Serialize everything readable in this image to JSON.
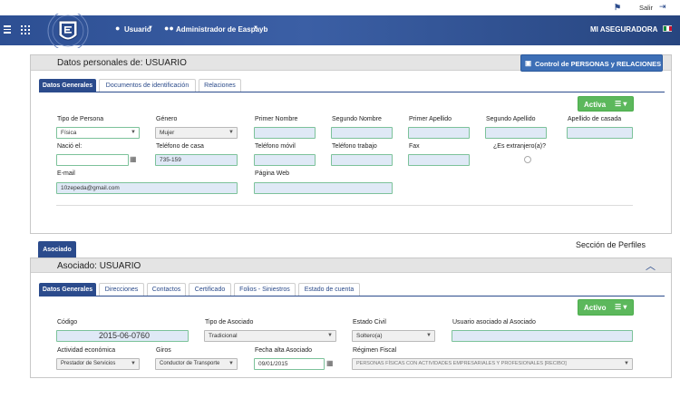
{
  "header": {
    "salir_label": "Salir",
    "usuario_menu": "Usuario",
    "admin_menu": "Administrador de Easpayb",
    "company": "MI ASEGURADORA"
  },
  "personal": {
    "title": "Datos personales de: USUARIO",
    "control_button": "Control de PERSONAS y RELACIONES",
    "tabs": [
      "Datos Generales",
      "Documentos de identificación",
      "Relaciones"
    ],
    "activa_button": "Activa",
    "fields": {
      "tipo_persona_label": "Tipo de Persona",
      "tipo_persona_value": "Física",
      "genero_label": "Género",
      "genero_value": "Mujer",
      "primer_nombre_label": "Primer Nombre",
      "segundo_nombre_label": "Segundo Nombre",
      "primer_apellido_label": "Primer Apellido",
      "segundo_apellido_label": "Segundo Apellido",
      "apellido_casada_label": "Apellido de casada",
      "nacio_label": "Nació el:",
      "tel_casa_label": "Teléfono de casa",
      "tel_casa_value": "735-159",
      "tel_movil_label": "Teléfono móvil",
      "tel_trabajo_label": "Teléfono trabajo",
      "fax_label": "Fax",
      "extranjero_label": "¿Es extranjero(a)?",
      "email_label": "E-mail",
      "email_value": "10zepeda@gmail.com",
      "web_label": "Página Web"
    }
  },
  "asociado": {
    "side_tab": "Asociado",
    "perfiles_label": "Sección de Perfiles",
    "title": "Asociado: USUARIO",
    "tabs": [
      "Datos Generales",
      "Direcciones",
      "Contactos",
      "Certificado",
      "Folios - Siniestros",
      "Estado de cuenta"
    ],
    "activo_button": "Activo",
    "fields": {
      "codigo_label": "Código",
      "codigo_value": "2015-06-0760",
      "tipo_asociado_label": "Tipo de Asociado",
      "tipo_asociado_value": "Tradicional",
      "estado_civil_label": "Estado Civil",
      "estado_civil_value": "Soltero(a)",
      "usuario_asociado_label": "Usuario asociado al Asociado",
      "actividad_label": "Actividad económica",
      "actividad_value": "Prestador de Servicios",
      "giros_label": "Giros",
      "giros_value": "Conductor de Transporte",
      "fecha_alta_label": "Fecha alta Asociado",
      "fecha_alta_value": "09/01/2015",
      "regimen_label": "Régimen Fiscal",
      "regimen_value": "PERSONAS FÍSICAS CON ACTIVIDADES EMPRESARIALES Y PROFESIONALES [RECIBO]"
    }
  },
  "colors": {
    "nav": "#2b4b8c",
    "green": "#5cb85c",
    "field": "#dfe9f6"
  }
}
